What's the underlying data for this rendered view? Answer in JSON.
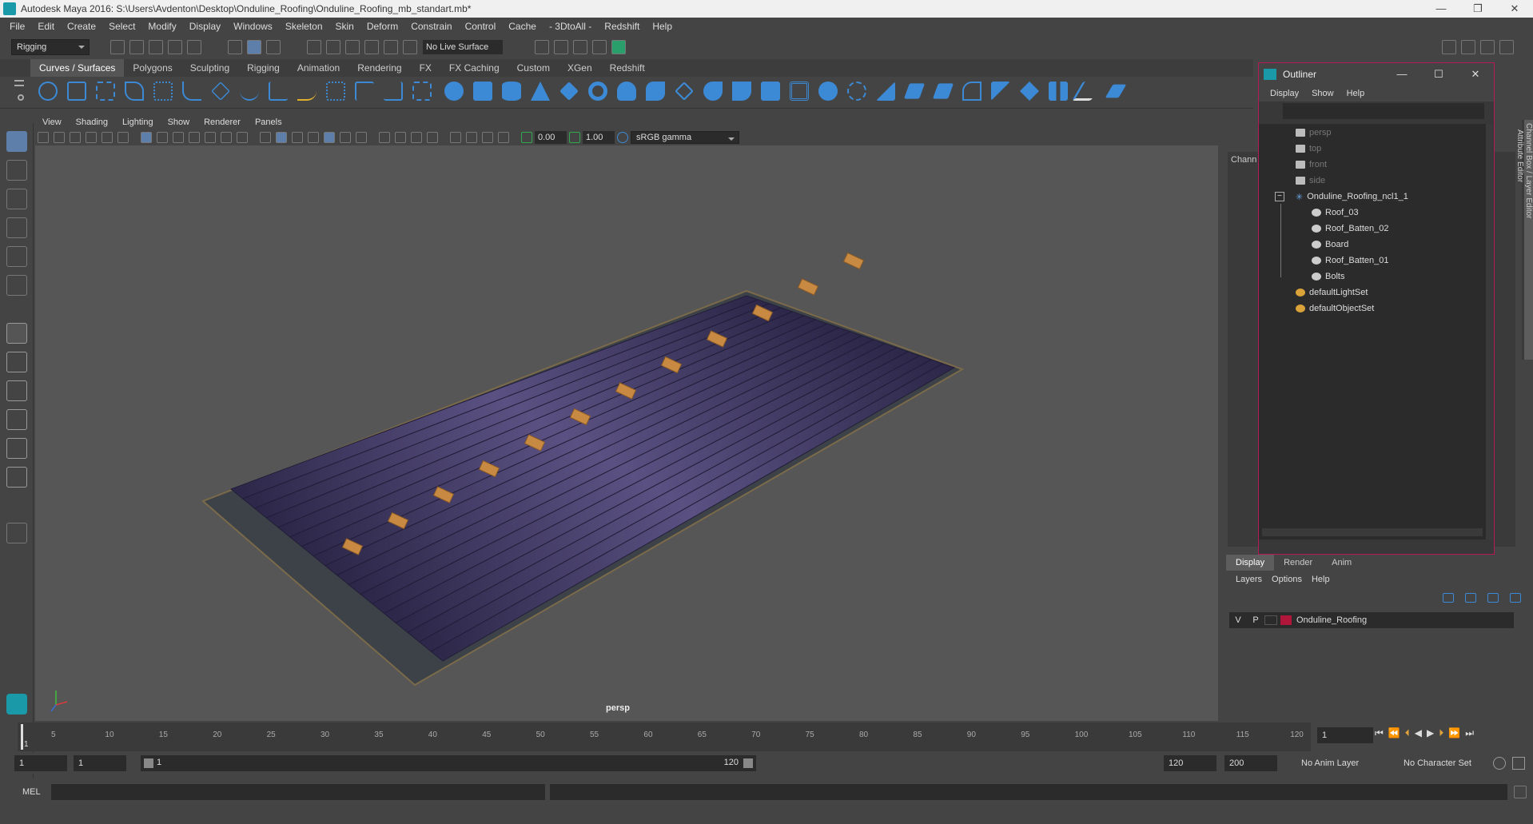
{
  "window": {
    "title": "Autodesk Maya 2016: S:\\Users\\Avdenton\\Desktop\\Onduline_Roofing\\Onduline_Roofing_mb_standart.mb*"
  },
  "menubar": [
    "File",
    "Edit",
    "Create",
    "Select",
    "Modify",
    "Display",
    "Windows",
    "Skeleton",
    "Skin",
    "Deform",
    "Constrain",
    "Control",
    "Cache",
    "- 3DtoAll -",
    "Redshift",
    "Help"
  ],
  "toolbar": {
    "mode": "Rigging",
    "live_surface": "No Live Surface"
  },
  "shelf_tabs": [
    "Curves / Surfaces",
    "Polygons",
    "Sculpting",
    "Rigging",
    "Animation",
    "Rendering",
    "FX",
    "FX Caching",
    "Custom",
    "XGen",
    "Redshift"
  ],
  "shelf_active": "Curves / Surfaces",
  "panel_menu": [
    "View",
    "Shading",
    "Lighting",
    "Show",
    "Renderer",
    "Panels"
  ],
  "panel_toolbar": {
    "exposure": "0.00",
    "gamma": "1.00",
    "color_space": "sRGB gamma"
  },
  "viewport": {
    "camera_label": "persp"
  },
  "outliner": {
    "title": "Outliner",
    "menu": [
      "Display",
      "Show",
      "Help"
    ],
    "items": [
      {
        "label": "persp",
        "dim": true
      },
      {
        "label": "top",
        "dim": true
      },
      {
        "label": "front",
        "dim": true
      },
      {
        "label": "side",
        "dim": true
      },
      {
        "label": "Onduline_Roofing_ncl1_1",
        "dim": false
      },
      {
        "label": "Roof_03",
        "dim": false
      },
      {
        "label": "Roof_Batten_02",
        "dim": false
      },
      {
        "label": "Board",
        "dim": false
      },
      {
        "label": "Roof_Batten_01",
        "dim": false
      },
      {
        "label": "Bolts",
        "dim": false
      },
      {
        "label": "defaultLightSet",
        "dim": false
      },
      {
        "label": "defaultObjectSet",
        "dim": false
      }
    ]
  },
  "channel_box_label": "Chann",
  "side_tabs": [
    "Channel Box / Layer Editor",
    "Attribute Editor"
  ],
  "layer_editor": {
    "tabs": [
      "Display",
      "Render",
      "Anim"
    ],
    "menu": [
      "Layers",
      "Options",
      "Help"
    ],
    "layer": {
      "v": "V",
      "p": "P",
      "name": "Onduline_Roofing",
      "color": "#b0163a"
    }
  },
  "timeline": {
    "ticks": [
      "5",
      "10",
      "15",
      "20",
      "25",
      "30",
      "35",
      "40",
      "45",
      "50",
      "55",
      "60",
      "65",
      "70",
      "75",
      "80",
      "85",
      "90",
      "95",
      "100",
      "105",
      "110",
      "115",
      "120"
    ],
    "current_frame": "1",
    "frame_field": "1"
  },
  "range": {
    "start": "1",
    "start2": "1",
    "range_start": "1",
    "range_end": "120",
    "end": "120",
    "end2": "200",
    "anim_layer": "No Anim Layer",
    "char_set": "No Character Set"
  },
  "mel": {
    "label": "MEL"
  }
}
